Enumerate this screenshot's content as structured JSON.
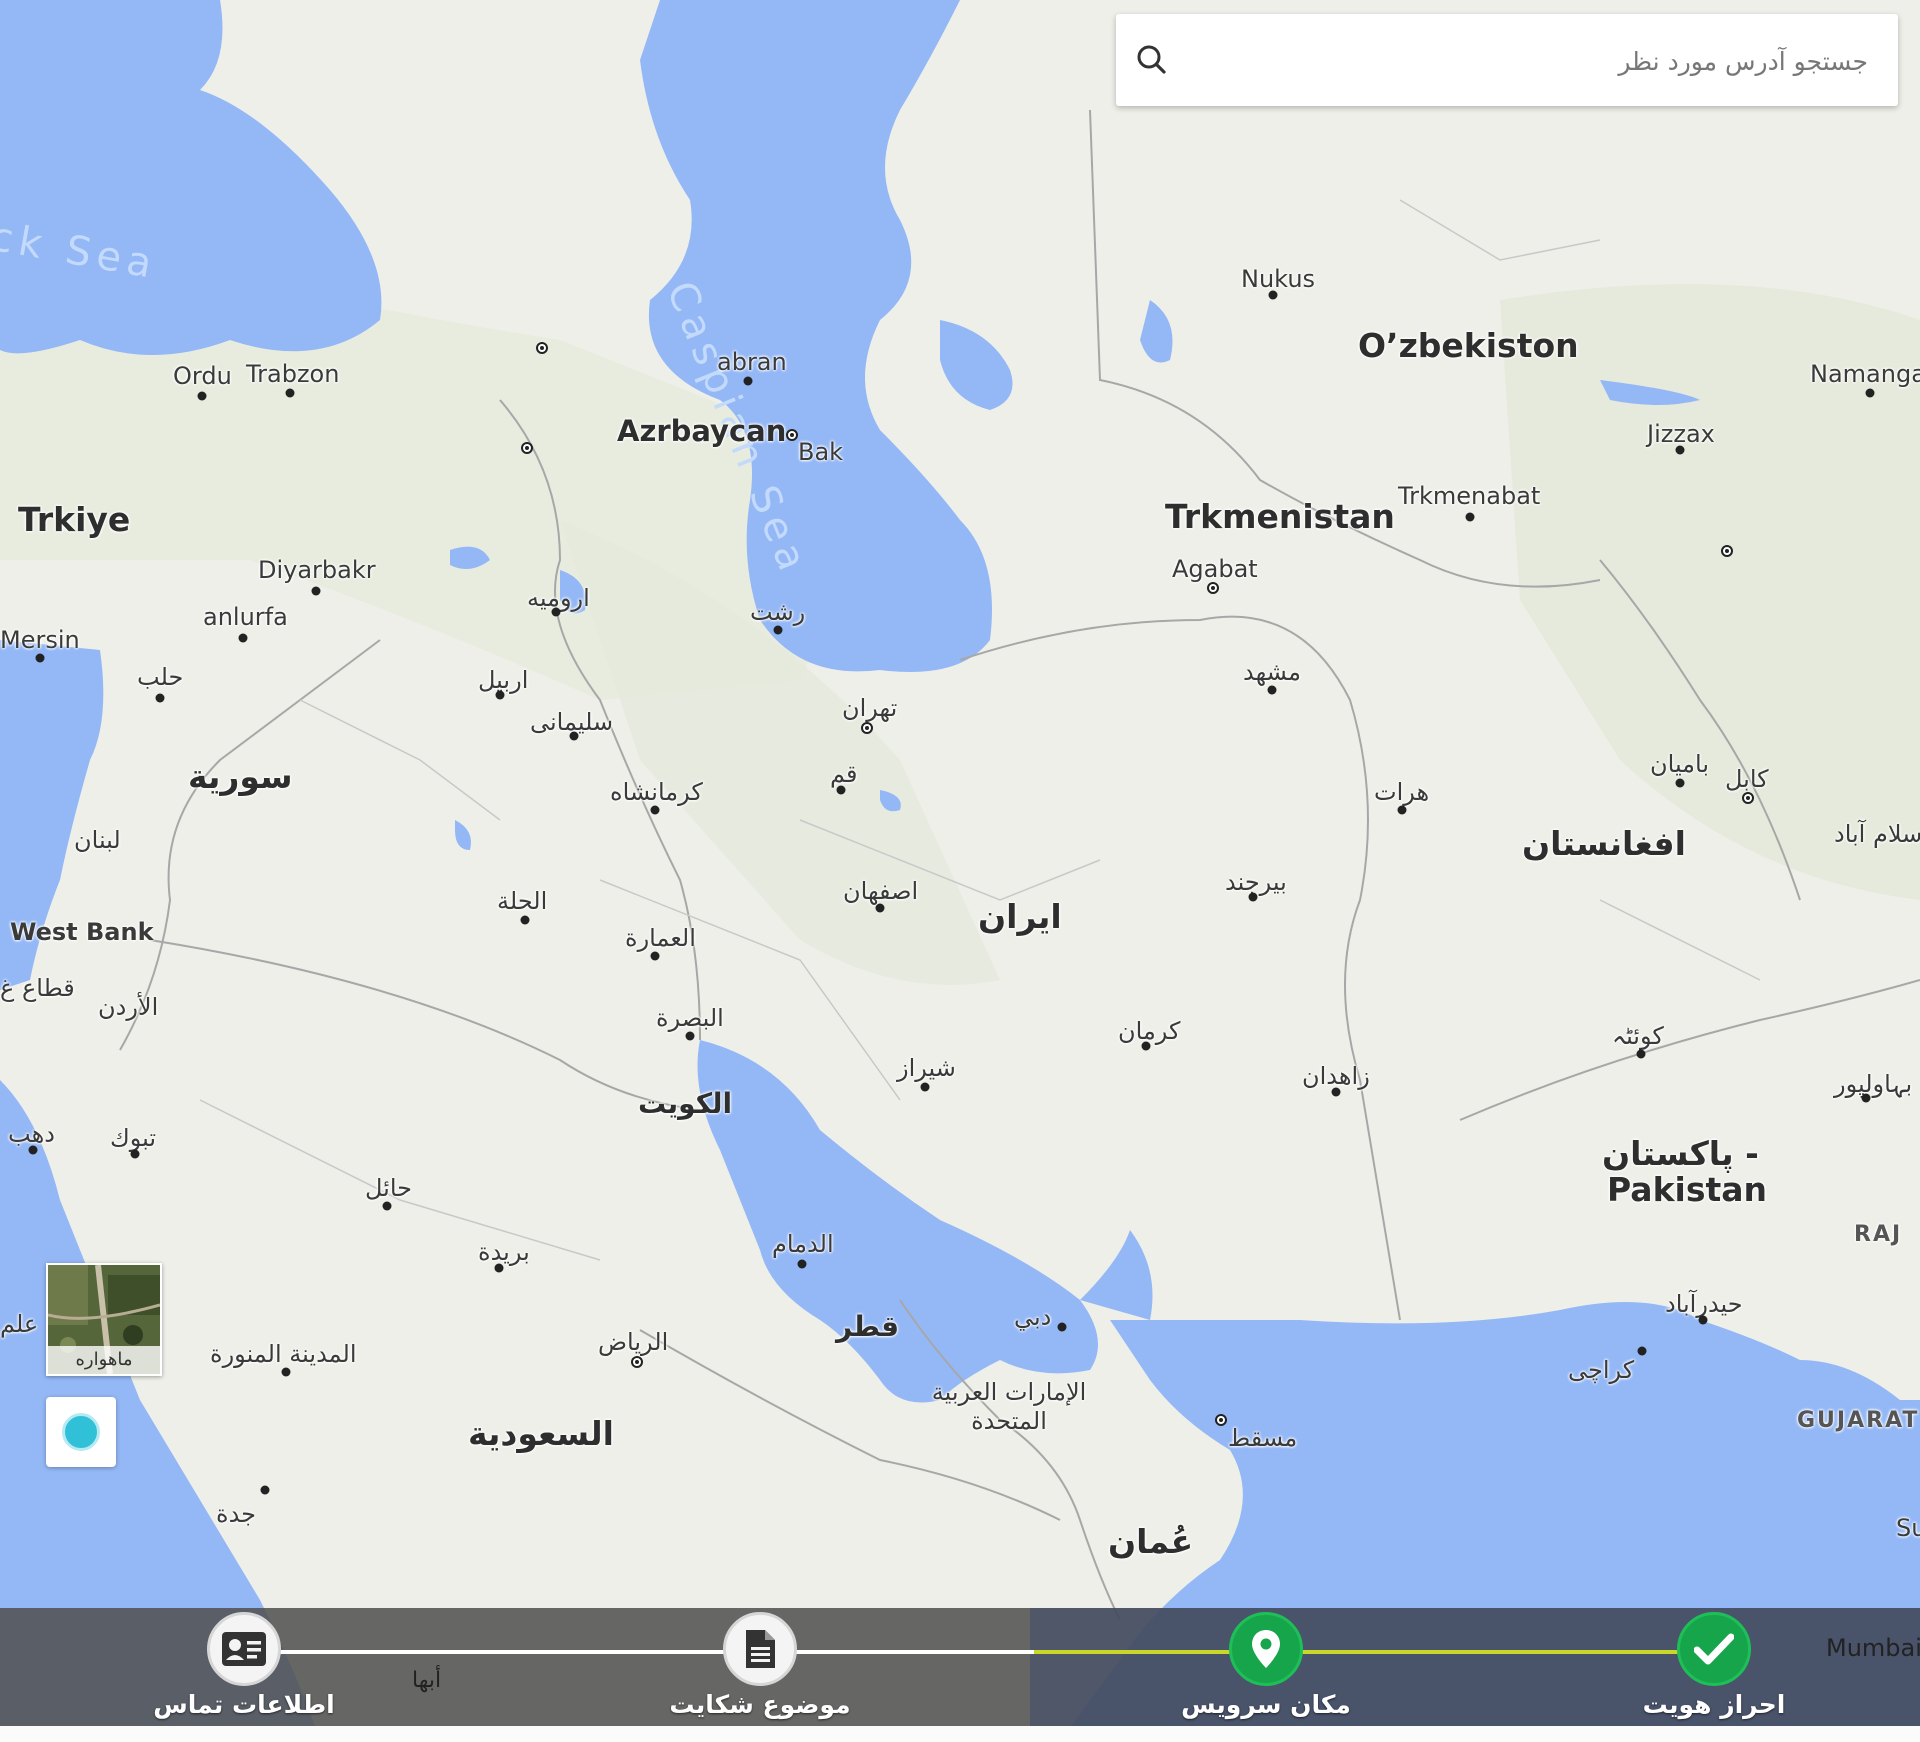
{
  "search": {
    "placeholder": "جستجو آدرس مورد نظر",
    "icon": "search-icon"
  },
  "map": {
    "colors": {
      "water": "#94b8f6",
      "land": "#efefe9",
      "road": "#ffffff",
      "border": "#a8a8a8"
    },
    "labels": {
      "black_sea": "ck Sea",
      "caspian_sea": "Caspian Sea",
      "ordu": "Ordu",
      "trabzon": "Trabzon",
      "abran": "abran",
      "azrbaycan": "Azrbaycan",
      "bak": "Bak",
      "nukus": "Nukus",
      "ozbekiston": "O’zbekiston",
      "namangan": "Namangan",
      "jizzax": "Jizzax",
      "trkmenabat": "Trkmenabat",
      "trkmenistan": "Trkmenistan",
      "agabat": "Agabat",
      "trkiye": "Trkiye",
      "diyarbakr": "Diyarbakr",
      "anlurfa": "anlurfa",
      "mersin": "Mersin",
      "urmia": "ارومیه",
      "rasht": "رشت",
      "mashhad": "مشهد",
      "aleppo": "حلب",
      "erbil": "اربیل",
      "sulaymaniyah": "سلیمانی",
      "tehran": "تهران",
      "syria": "سورية",
      "qom": "قم",
      "kermanshah": "کرمانشاه",
      "herat": "هرات",
      "bamyan": "بامیان",
      "kabul": "کابل",
      "islamabad": "سلام آباد",
      "afghanistan": "افغانستان",
      "lebanon": "لبنان",
      "birjand": "بیرجند",
      "hillah": "الحلة",
      "isfahan": "اصفهان",
      "iran": "ایران",
      "west_bank": "West Bank",
      "amarah": "العمارة",
      "gaza": "قطاع غ",
      "jordan": "الأردن",
      "basra": "البصرة",
      "kerman": "کرمان",
      "quetta": "کوئٹہ",
      "shiraz": "شیراز",
      "zahedan": "زاهدان",
      "bahawalpur": "بہاولپور",
      "kuwait": "الكويت",
      "dahab": "دهب",
      "tabuk": "تبوك",
      "pakistan_ur": "پاکستان -",
      "pakistan": "Pakistan",
      "hail": "حائل",
      "raj": "RAJ",
      "buraidah": "بريدة",
      "dammam": "الدمام",
      "hyderabad": "حیدرآباد",
      "alam": "علم",
      "qatar": "قطر",
      "dubai": "دبي",
      "madinah": "المدينة المنورة",
      "riyadh": "الرياض",
      "karachi": "کراچی",
      "uae": "الإمارات العربية المتحدة",
      "gujarat": "GUJARAT",
      "muscat": "مسقط",
      "saudi": "السعودية",
      "jeddah": "جدة",
      "oman": "عُمان",
      "su": "Su",
      "abha": "أبها",
      "mumbai": "Mumbai"
    }
  },
  "controls": {
    "satellite_label": "ماهواره",
    "locate_icon": "my-location-icon"
  },
  "steps": {
    "items": [
      {
        "label": "اطلاعات تماس",
        "icon": "contact-card-icon",
        "state": "inactive"
      },
      {
        "label": "موضوع شکایت",
        "icon": "document-icon",
        "state": "inactive"
      },
      {
        "label": "مکان سرویس",
        "icon": "map-pin-icon",
        "state": "active"
      },
      {
        "label": "احراز هویت",
        "icon": "checkmark-icon",
        "state": "done"
      }
    ],
    "colors": {
      "done": "#17a54b",
      "line_done": "#c9d62a",
      "line_todo": "#ffffff"
    }
  }
}
